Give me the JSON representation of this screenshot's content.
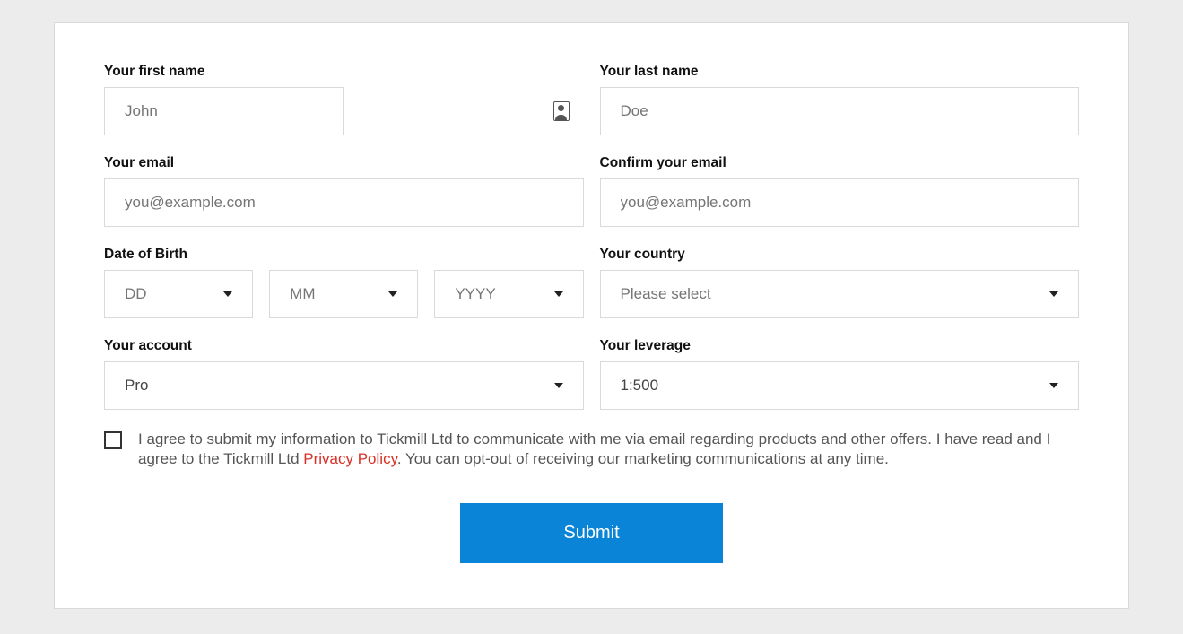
{
  "labels": {
    "first_name": "Your first name",
    "last_name": "Your last name",
    "email": "Your email",
    "confirm_email": "Confirm your email",
    "dob": "Date of Birth",
    "country": "Your country",
    "account": "Your account",
    "leverage": "Your leverage"
  },
  "placeholders": {
    "first_name": "John",
    "last_name": "Doe",
    "email": "you@example.com",
    "confirm_email": "you@example.com"
  },
  "dob": {
    "dd": "DD",
    "mm": "MM",
    "yyyy": "YYYY"
  },
  "country": {
    "value": "Please select"
  },
  "account": {
    "value": "Pro"
  },
  "leverage": {
    "value": "1:500"
  },
  "consent": {
    "part1": "I agree to submit my information to Tickmill Ltd to communicate with me via email regarding products and other offers. I have read and I agree to the Tickmill Ltd ",
    "link": "Privacy Policy",
    "part2": ". You can opt-out of receiving our marketing communications at any time."
  },
  "submit": "Submit"
}
